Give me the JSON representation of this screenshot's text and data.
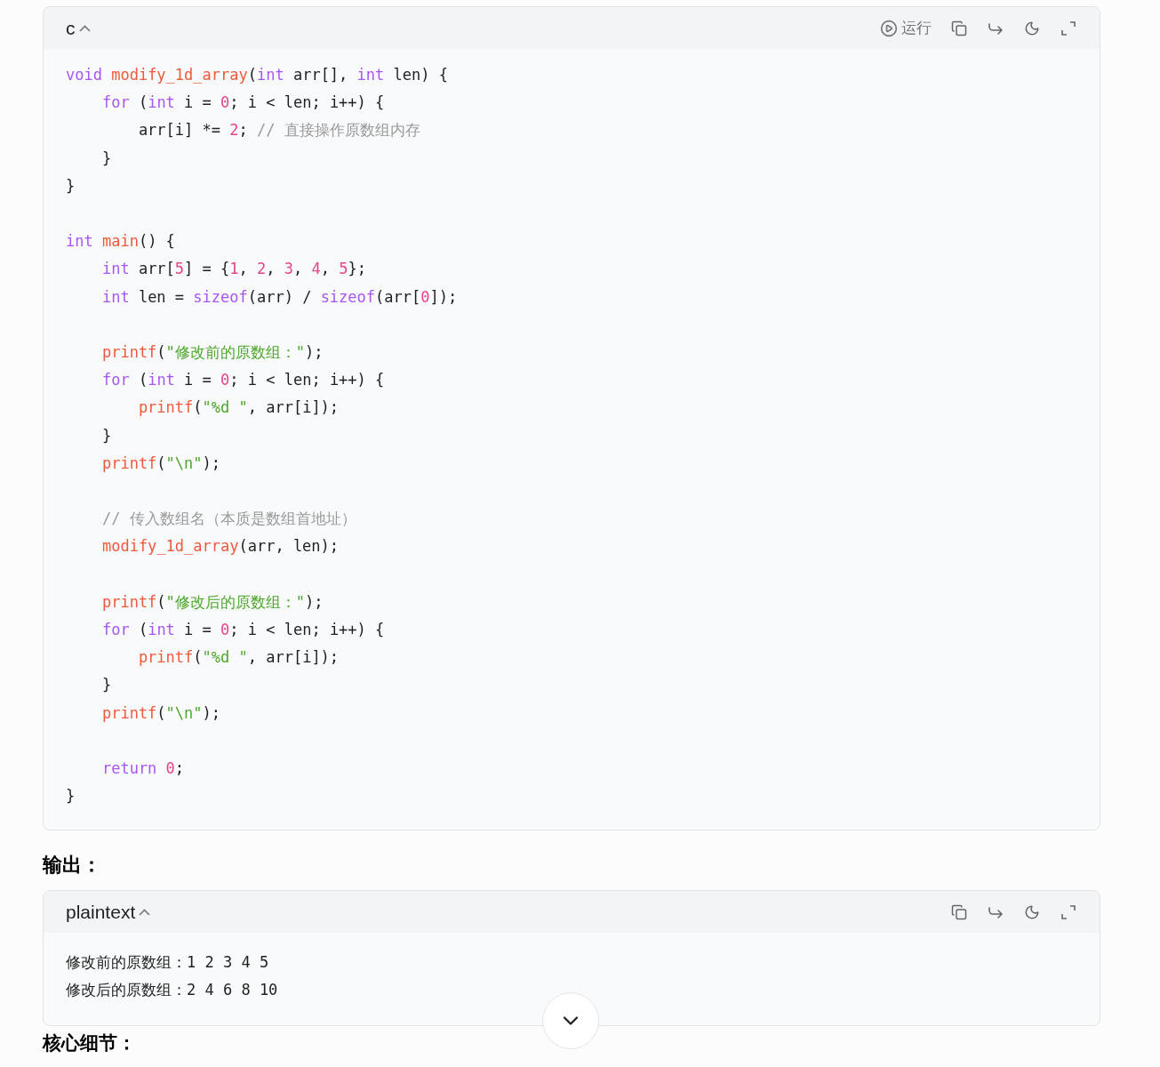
{
  "code_block": {
    "language": "c",
    "run_label": "运行",
    "lines": [
      {
        "kind": "code",
        "tokens": [
          {
            "kind": "kw",
            "text": "void "
          },
          {
            "kind": "fn",
            "text": "modify_1d_array"
          },
          {
            "kind": "plain",
            "text": "("
          },
          {
            "kind": "kw",
            "text": "int"
          },
          {
            "kind": "plain",
            "text": " arr[], "
          },
          {
            "kind": "kw",
            "text": "int"
          },
          {
            "kind": "plain",
            "text": " len) {"
          }
        ]
      },
      {
        "kind": "code",
        "tokens": [
          {
            "kind": "kw",
            "text": "    for"
          },
          {
            "kind": "plain",
            "text": " ("
          },
          {
            "kind": "kw",
            "text": "int"
          },
          {
            "kind": "plain",
            "text": " i = "
          },
          {
            "kind": "num",
            "text": "0"
          },
          {
            "kind": "plain",
            "text": "; i < len; i++) {"
          }
        ]
      },
      {
        "kind": "code",
        "tokens": [
          {
            "kind": "plain",
            "text": "        arr[i] *= "
          },
          {
            "kind": "num",
            "text": "2"
          },
          {
            "kind": "plain",
            "text": "; "
          },
          {
            "kind": "cmt",
            "text": "// 直接操作原数组内存"
          }
        ]
      },
      {
        "kind": "code",
        "tokens": [
          {
            "kind": "plain",
            "text": "    }"
          }
        ]
      },
      {
        "kind": "code",
        "tokens": [
          {
            "kind": "plain",
            "text": "}"
          }
        ]
      },
      {
        "kind": "blank"
      },
      {
        "kind": "code",
        "tokens": [
          {
            "kind": "kw",
            "text": "int "
          },
          {
            "kind": "fn",
            "text": "main"
          },
          {
            "kind": "plain",
            "text": "() {"
          }
        ]
      },
      {
        "kind": "code",
        "tokens": [
          {
            "kind": "kw",
            "text": "    int"
          },
          {
            "kind": "plain",
            "text": " arr["
          },
          {
            "kind": "num",
            "text": "5"
          },
          {
            "kind": "plain",
            "text": "] = {"
          },
          {
            "kind": "num",
            "text": "1"
          },
          {
            "kind": "plain",
            "text": ", "
          },
          {
            "kind": "num",
            "text": "2"
          },
          {
            "kind": "plain",
            "text": ", "
          },
          {
            "kind": "num",
            "text": "3"
          },
          {
            "kind": "plain",
            "text": ", "
          },
          {
            "kind": "num",
            "text": "4"
          },
          {
            "kind": "plain",
            "text": ", "
          },
          {
            "kind": "num",
            "text": "5"
          },
          {
            "kind": "plain",
            "text": "};"
          }
        ]
      },
      {
        "kind": "code",
        "tokens": [
          {
            "kind": "kw",
            "text": "    int"
          },
          {
            "kind": "plain",
            "text": " len = "
          },
          {
            "kind": "kw",
            "text": "sizeof"
          },
          {
            "kind": "plain",
            "text": "(arr) / "
          },
          {
            "kind": "kw",
            "text": "sizeof"
          },
          {
            "kind": "plain",
            "text": "(arr["
          },
          {
            "kind": "num",
            "text": "0"
          },
          {
            "kind": "plain",
            "text": "]);"
          }
        ]
      },
      {
        "kind": "blank"
      },
      {
        "kind": "code",
        "tokens": [
          {
            "kind": "fn",
            "text": "    printf"
          },
          {
            "kind": "plain",
            "text": "("
          },
          {
            "kind": "str",
            "text": "\"修改前的原数组：\""
          },
          {
            "kind": "plain",
            "text": ");"
          }
        ]
      },
      {
        "kind": "code",
        "tokens": [
          {
            "kind": "kw",
            "text": "    for"
          },
          {
            "kind": "plain",
            "text": " ("
          },
          {
            "kind": "kw",
            "text": "int"
          },
          {
            "kind": "plain",
            "text": " i = "
          },
          {
            "kind": "num",
            "text": "0"
          },
          {
            "kind": "plain",
            "text": "; i < len; i++) {"
          }
        ]
      },
      {
        "kind": "code",
        "tokens": [
          {
            "kind": "fn",
            "text": "        printf"
          },
          {
            "kind": "plain",
            "text": "("
          },
          {
            "kind": "str",
            "text": "\"%d \""
          },
          {
            "kind": "plain",
            "text": ", arr[i]);"
          }
        ]
      },
      {
        "kind": "code",
        "tokens": [
          {
            "kind": "plain",
            "text": "    }"
          }
        ]
      },
      {
        "kind": "code",
        "tokens": [
          {
            "kind": "fn",
            "text": "    printf"
          },
          {
            "kind": "plain",
            "text": "("
          },
          {
            "kind": "str",
            "text": "\"\\n\""
          },
          {
            "kind": "plain",
            "text": ");"
          }
        ]
      },
      {
        "kind": "blank"
      },
      {
        "kind": "code",
        "tokens": [
          {
            "kind": "cmt",
            "text": "    // 传入数组名（本质是数组首地址）"
          }
        ]
      },
      {
        "kind": "code",
        "tokens": [
          {
            "kind": "fn",
            "text": "    modify_1d_array"
          },
          {
            "kind": "plain",
            "text": "(arr, len);"
          }
        ]
      },
      {
        "kind": "blank"
      },
      {
        "kind": "code",
        "tokens": [
          {
            "kind": "fn",
            "text": "    printf"
          },
          {
            "kind": "plain",
            "text": "("
          },
          {
            "kind": "str",
            "text": "\"修改后的原数组：\""
          },
          {
            "kind": "plain",
            "text": ");"
          }
        ]
      },
      {
        "kind": "code",
        "tokens": [
          {
            "kind": "kw",
            "text": "    for"
          },
          {
            "kind": "plain",
            "text": " ("
          },
          {
            "kind": "kw",
            "text": "int"
          },
          {
            "kind": "plain",
            "text": " i = "
          },
          {
            "kind": "num",
            "text": "0"
          },
          {
            "kind": "plain",
            "text": "; i < len; i++) {"
          }
        ]
      },
      {
        "kind": "code",
        "tokens": [
          {
            "kind": "fn",
            "text": "        printf"
          },
          {
            "kind": "plain",
            "text": "("
          },
          {
            "kind": "str",
            "text": "\"%d \""
          },
          {
            "kind": "plain",
            "text": ", arr[i]);"
          }
        ]
      },
      {
        "kind": "code",
        "tokens": [
          {
            "kind": "plain",
            "text": "    }"
          }
        ]
      },
      {
        "kind": "code",
        "tokens": [
          {
            "kind": "fn",
            "text": "    printf"
          },
          {
            "kind": "plain",
            "text": "("
          },
          {
            "kind": "str",
            "text": "\"\\n\""
          },
          {
            "kind": "plain",
            "text": ");"
          }
        ]
      },
      {
        "kind": "blank"
      },
      {
        "kind": "code",
        "tokens": [
          {
            "kind": "kw",
            "text": "    return "
          },
          {
            "kind": "num",
            "text": "0"
          },
          {
            "kind": "plain",
            "text": ";"
          }
        ]
      },
      {
        "kind": "code",
        "tokens": [
          {
            "kind": "plain",
            "text": "}"
          }
        ]
      }
    ]
  },
  "output_heading": "输出：",
  "output_block": {
    "language": "plaintext",
    "lines": [
      "修改前的原数组：1 2 3 4 5",
      "修改后的原数组：2 4 6 8 10"
    ]
  },
  "next_heading": "核心细节："
}
